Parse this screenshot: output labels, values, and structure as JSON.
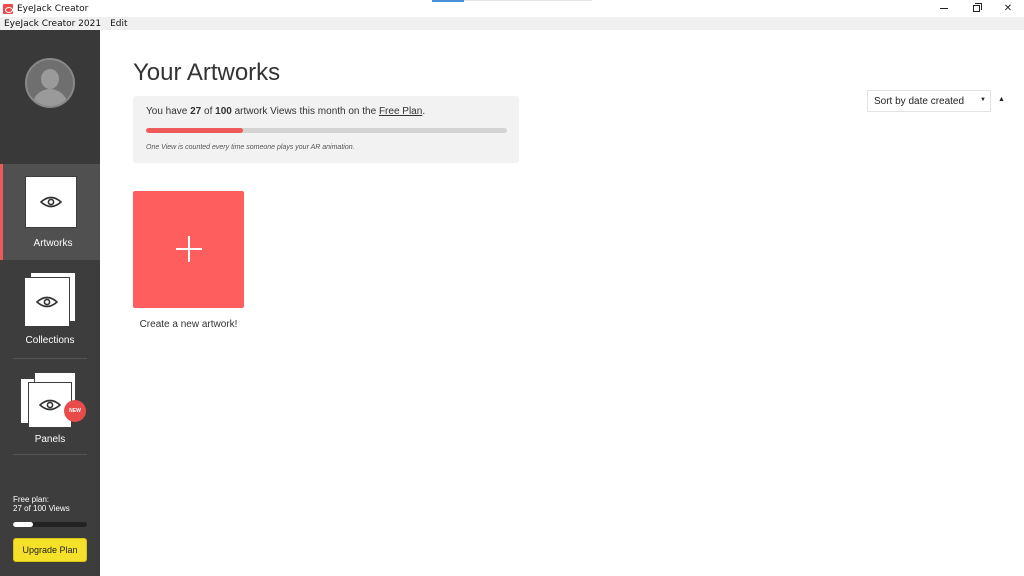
{
  "window": {
    "title": "EyeJack Creator",
    "controls": {
      "minimize": "minimize",
      "restore": "restore",
      "close": "✕"
    }
  },
  "menubar": {
    "items": [
      "EyeJack Creator 2021",
      "Edit"
    ]
  },
  "sidebar": {
    "nav": [
      {
        "label": "Artworks",
        "icon": "eye-icon",
        "active": true
      },
      {
        "label": "Collections",
        "icon": "eye-icon",
        "active": false
      },
      {
        "label": "Panels",
        "icon": "eye-icon",
        "active": false,
        "badge": "NEW"
      }
    ],
    "plan": {
      "title": "Free plan:",
      "usage": "27 of 100 Views",
      "progress": 0.27,
      "upgrade_label": "Upgrade Plan"
    }
  },
  "main": {
    "title": "Your Artworks",
    "usage": {
      "prefix": "You have ",
      "used": "27",
      "of": " of ",
      "limit": "100",
      "suffix": " artwork Views this month on the ",
      "plan_link": "Free Plan",
      "end": ".",
      "progress": 0.27,
      "note": "One View is counted every time someone plays your AR animation."
    },
    "sort": {
      "selected": "Sort by date created",
      "caret": "▼",
      "direction": "▲"
    },
    "create": {
      "label": "Create a new artwork!"
    }
  },
  "colors": {
    "accent": "#ff5e5e",
    "sidebar": "#3d3d3d",
    "upgrade": "#f6e12a"
  }
}
